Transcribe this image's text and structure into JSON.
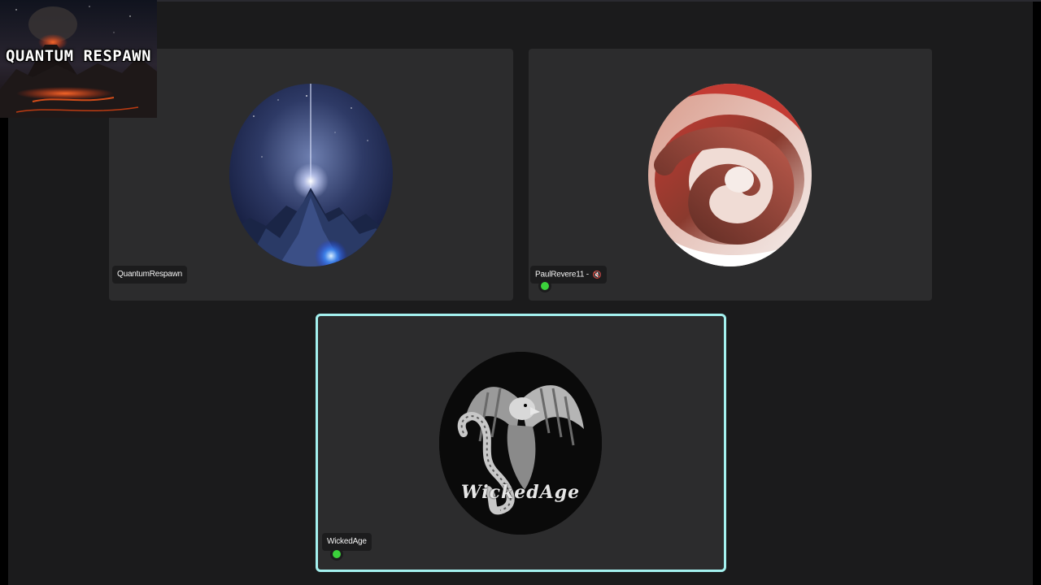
{
  "overlay": {
    "title": "QUANTUM RESPAWN"
  },
  "participants": [
    {
      "name": "QuantumRespawn",
      "avatar": "mountain-star-avatar",
      "mic_muted": false,
      "online": false,
      "speaking": false
    },
    {
      "name": "PaulRevere11 -",
      "avatar": "ribbon-spiral-avatar",
      "mic_muted": true,
      "online": true,
      "speaking": false
    },
    {
      "name": "WickedAge",
      "avatar": "eagle-serpent-avatar",
      "avatar_text": "WickedAge",
      "mic_muted": false,
      "online": true,
      "speaking": true
    }
  ],
  "colors": {
    "background": "#1b1b1c",
    "tile": "#2c2c2d",
    "speaking_border": "#a4f1ef",
    "online_dot": "#3bd13b",
    "name_tag": "#1c1c1d"
  }
}
